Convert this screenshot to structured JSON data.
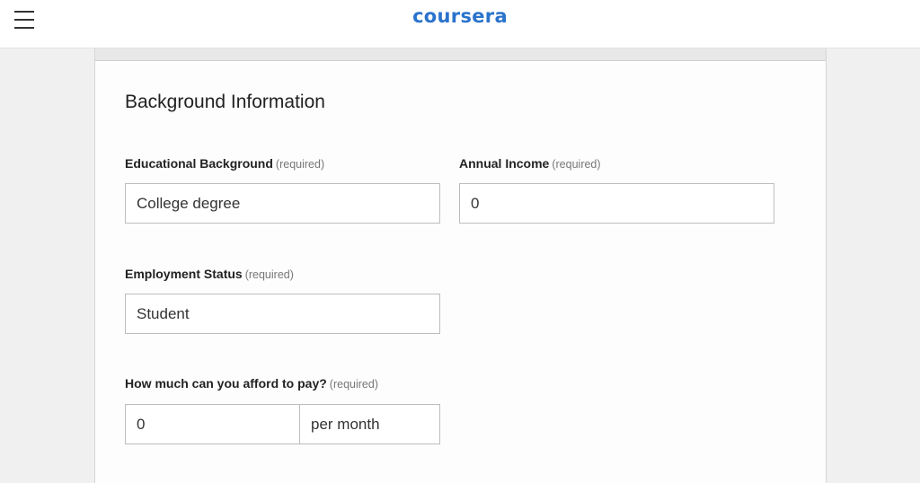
{
  "header": {
    "logo_text": "coursera",
    "menu_icon": "hamburger-menu-icon",
    "brand_color": "#2a73cc"
  },
  "form": {
    "section_title": "Background Information",
    "required_text": "(required)",
    "educational_background": {
      "label": "Educational Background",
      "value": "College degree"
    },
    "annual_income": {
      "label": "Annual Income",
      "value": "0"
    },
    "employment_status": {
      "label": "Employment Status",
      "value": "Student"
    },
    "afford_to_pay": {
      "label": "How much can you afford to pay?",
      "amount": "0",
      "period": "per month"
    }
  }
}
